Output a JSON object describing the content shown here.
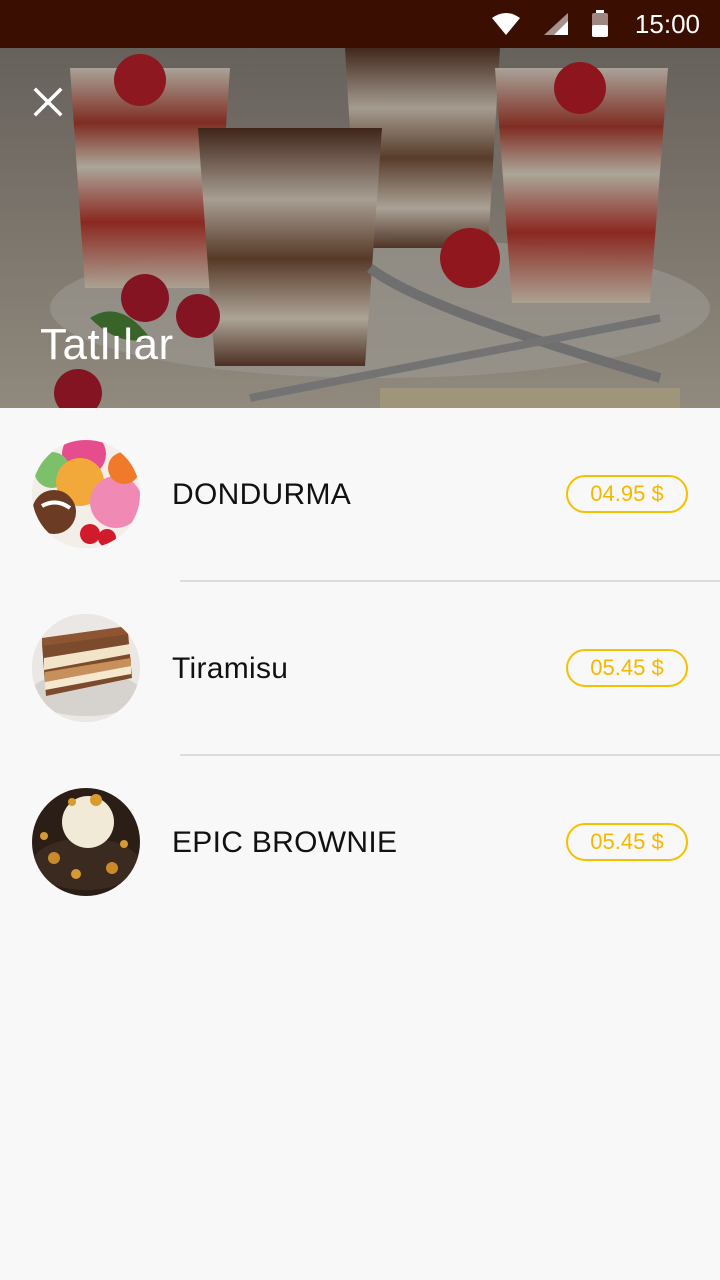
{
  "status_bar": {
    "time": "15:00",
    "icons": [
      "wifi-icon",
      "cell-signal-icon",
      "battery-icon"
    ]
  },
  "header": {
    "title": "Tatlılar",
    "close_icon": "close-icon"
  },
  "items": [
    {
      "name": "DONDURMA",
      "price": "04.95 $",
      "image": "ice-cream-thumbnail"
    },
    {
      "name": "Tiramisu",
      "price": "05.45 $",
      "image": "tiramisu-thumbnail"
    },
    {
      "name": "EPIC BROWNIE",
      "price": "05.45 $",
      "image": "brownie-thumbnail"
    }
  ],
  "colors": {
    "status_bar_bg": "#3a0f01",
    "price_accent": "#f5c000",
    "background": "#f8f8f8"
  }
}
